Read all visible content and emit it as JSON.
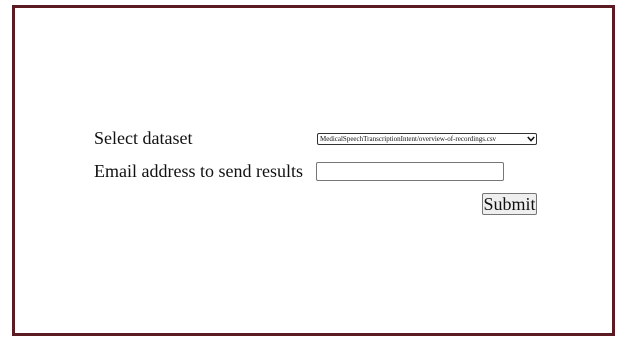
{
  "form": {
    "dataset_label": "Select dataset",
    "dataset_selected": "MedicalSpeechTranscriptionIntent/overview-of-recordings.csv",
    "email_label": "Email address to send results",
    "email_value": "",
    "submit_label": "Submit"
  },
  "colors": {
    "frame_border": "#5c1a22"
  },
  "icons": {
    "select_arrow": "chevron-down-icon"
  }
}
